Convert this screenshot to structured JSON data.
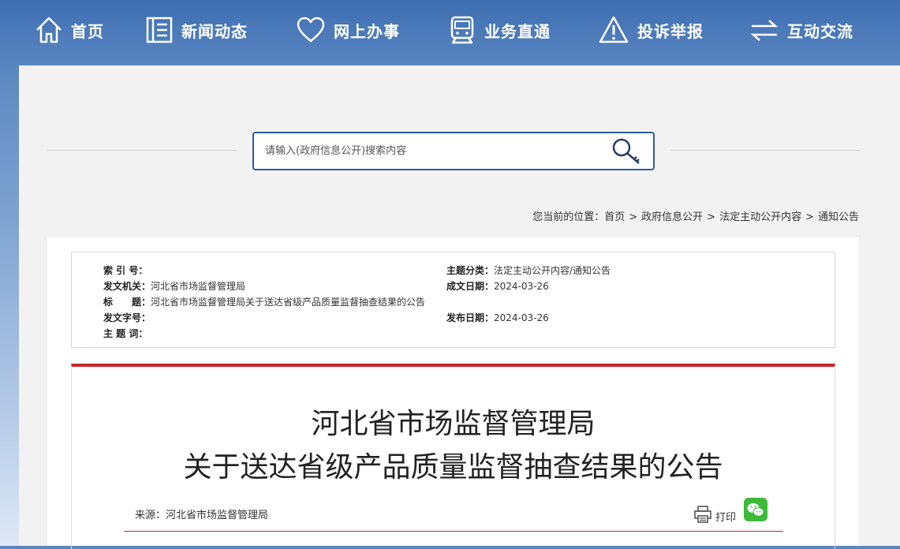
{
  "nav": {
    "items": [
      {
        "label": "首页",
        "icon": "home-icon"
      },
      {
        "label": "新闻动态",
        "icon": "news-icon"
      },
      {
        "label": "网上办事",
        "icon": "heart-icon"
      },
      {
        "label": "业务直通",
        "icon": "train-icon"
      },
      {
        "label": "投诉举报",
        "icon": "warning-icon"
      },
      {
        "label": "互动交流",
        "icon": "exchange-icon"
      }
    ]
  },
  "search": {
    "placeholder": "请输入(政府信息公开)搜索内容",
    "icon": "search-key-icon"
  },
  "breadcrumb": {
    "prefix": "您当前的位置：",
    "items": [
      "首页",
      "政府信息公开",
      "法定主动公开内容",
      "通知公告"
    ],
    "separator": ">"
  },
  "meta": {
    "index_label": "索 引 号：",
    "index_value": "",
    "issuer_label": "发文机关：",
    "issuer_value": "河北省市场监督管理局",
    "title_label": "标　　题：",
    "title_value": "河北省市场监督管理局关于送达省级产品质量监督抽查结果的公告",
    "doc_no_label": "发文字号：",
    "doc_no_value": "",
    "keywords_label": "主 题 词：",
    "keywords_value": "",
    "topic_label": "主题分类：",
    "topic_value": "法定主动公开内容/通知公告",
    "created_label": "成文日期：",
    "created_value": "2024-03-26",
    "published_label": "发布日期：",
    "published_value": "2024-03-26"
  },
  "article": {
    "title_line1": "河北省市场监督管理局",
    "title_line2": "关于送达省级产品质量监督抽查结果的公告",
    "source": "来源：河北省市场监督管理局",
    "print_label": "打印",
    "print_icon": "printer-icon",
    "share_icon": "wechat-icon"
  },
  "colors": {
    "accent_red": "#c9282d",
    "search_border": "#2a5aa0",
    "wechat_green": "#3dba3a"
  }
}
